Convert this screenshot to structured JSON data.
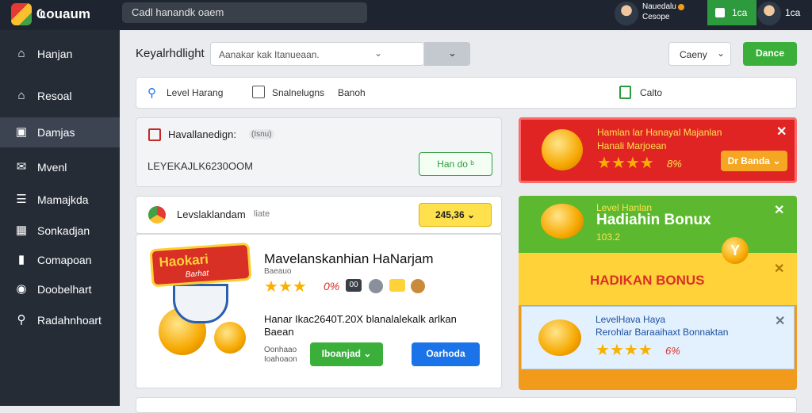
{
  "topbar": {
    "brand": "Ҩouaum",
    "search": "Cadl hanandk oaem",
    "user1_line1": "Nauedalu",
    "user1_line2": "Cesope",
    "green_label": "1ca",
    "user2_label": "1ca"
  },
  "sidebar": {
    "items": [
      {
        "label": "Hanjan",
        "icon": "home-icon"
      },
      {
        "label": "Resoal",
        "icon": "home-icon"
      },
      {
        "label": "Damjas",
        "icon": "user-icon"
      },
      {
        "label": "Mvenl",
        "icon": "mail-icon"
      },
      {
        "label": "Mamajkda",
        "icon": "list-icon"
      },
      {
        "label": "Sonkadjan",
        "icon": "calendar-icon"
      },
      {
        "label": "Comapoan",
        "icon": "bar-chart-icon"
      },
      {
        "label": "Doobelhart",
        "icon": "chrome-icon"
      },
      {
        "label": "Radahnhoart",
        "icon": "wrench-icon"
      }
    ]
  },
  "toolbar": {
    "label": "Keyalrhdlight",
    "select_value": "Aanakar kak Itanueaan.",
    "dropdown_label": "Caeny",
    "create_label": "Dance"
  },
  "filters": {
    "level": "Level Harang",
    "checkbox_label": "Snalnelugns",
    "checkbox_extra": "Banoh",
    "export": "Calto"
  },
  "card_a": {
    "title": "Havallanedign:",
    "tag": "(Isnu)",
    "code": "LEYEKAJLK6230OOM",
    "button": "Han do ᵇ"
  },
  "card_b": {
    "title": "Levslaklandam",
    "subtitle": "liate",
    "badge": "245,36"
  },
  "featured": {
    "logo_line1": "Haokari",
    "logo_line2": "Barhat",
    "title": "Mavelanskanhian HaNarjam",
    "subtitle": "Baeauo",
    "rating": "0%",
    "icon_badge": "00",
    "description": "Hanar Ikac2640T.20X blanalalekalk arlkan Baean",
    "meta1": "Oonhaao",
    "meta2": "Ioahoaon",
    "btn_green": "Iboanjad",
    "btn_blue": "Oarhoda"
  },
  "promo_red": {
    "line1": "Hamlan lar Hanayal Majanlan",
    "line2": "Hanali Marjoean",
    "rating": "8%",
    "btn": "Dr Banda"
  },
  "promo_green": {
    "line1": "Level Hanlan",
    "line2": "Hadiahin Bonux",
    "line3": "103.2",
    "badge": "Y"
  },
  "promo_yellow": {
    "text": "HADIKAN BONUS"
  },
  "promo_blue": {
    "line1": "LevelHava Haya",
    "line2": "Rerohlar Baraaihaxt Bonnaktan",
    "rating": "6%"
  },
  "colors": {
    "red": "#e02424",
    "green": "#5cb82e",
    "yellow": "#ffd23a",
    "orange": "#f29a1b",
    "blue": "#1a73e8",
    "button_green": "#3ab03a"
  }
}
